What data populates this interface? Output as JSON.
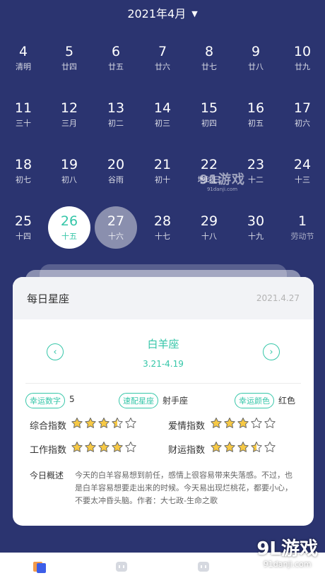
{
  "header": {
    "month": "2021年4月",
    "caret": "▼"
  },
  "calendar": {
    "rows": [
      [
        {
          "d": "4",
          "l": "清明"
        },
        {
          "d": "5",
          "l": "廿四"
        },
        {
          "d": "6",
          "l": "廿五"
        },
        {
          "d": "7",
          "l": "廿六"
        },
        {
          "d": "8",
          "l": "廿七"
        },
        {
          "d": "9",
          "l": "廿八"
        },
        {
          "d": "10",
          "l": "廿九"
        }
      ],
      [
        {
          "d": "11",
          "l": "三十"
        },
        {
          "d": "12",
          "l": "三月"
        },
        {
          "d": "13",
          "l": "初二"
        },
        {
          "d": "14",
          "l": "初三"
        },
        {
          "d": "15",
          "l": "初四"
        },
        {
          "d": "16",
          "l": "初五"
        },
        {
          "d": "17",
          "l": "初六"
        }
      ],
      [
        {
          "d": "18",
          "l": "初七"
        },
        {
          "d": "19",
          "l": "初八"
        },
        {
          "d": "20",
          "l": "谷雨"
        },
        {
          "d": "21",
          "l": "初十"
        },
        {
          "d": "22",
          "l": "地球日"
        },
        {
          "d": "23",
          "l": "十二"
        },
        {
          "d": "24",
          "l": "十三"
        }
      ],
      [
        {
          "d": "25",
          "l": "十四"
        },
        {
          "d": "26",
          "l": "十五",
          "state": "today"
        },
        {
          "d": "27",
          "l": "十六",
          "state": "selected"
        },
        {
          "d": "28",
          "l": "十七"
        },
        {
          "d": "29",
          "l": "十八"
        },
        {
          "d": "30",
          "l": "十九"
        },
        {
          "d": "1",
          "l": "劳动节",
          "state": "holiday"
        }
      ]
    ]
  },
  "horoscope": {
    "title": "每日星座",
    "date": "2021.4.27",
    "sign": "白羊座",
    "range": "3.21-4.19",
    "prev_icon": "chevron-left-icon",
    "next_icon": "chevron-right-icon",
    "lucky_number_label": "幸运数字",
    "lucky_number": "5",
    "match_label": "速配星座",
    "match": "射手座",
    "lucky_color_label": "幸运颜色",
    "lucky_color": "红色",
    "stats": [
      {
        "label": "综合指数",
        "rating": 3.5
      },
      {
        "label": "爱情指数",
        "rating": 3
      },
      {
        "label": "工作指数",
        "rating": 4
      },
      {
        "label": "财运指数",
        "rating": 3.5
      }
    ],
    "summary_label": "今日概述",
    "summary": "今天的白羊容易想到前任，感情上很容易带来失落感。不过，也是白羊容易想要走出来的时候。今天易出现烂桃花，都要小心，不要太冲昏头脑。作者：大七政-生命之歌"
  },
  "colors": {
    "bg": "#2b3470",
    "accent": "#35c6a8",
    "star": "#f7c945"
  },
  "bottom_tabs": [
    {
      "name": "calendar-tab-icon"
    },
    {
      "name": "robot-tab-icon"
    },
    {
      "name": "robot-tab-icon-2"
    }
  ],
  "watermarks": {
    "small": "91游戏",
    "small_url": "91danji.com",
    "big": "9L游戏",
    "big_url": "91danji.com"
  }
}
